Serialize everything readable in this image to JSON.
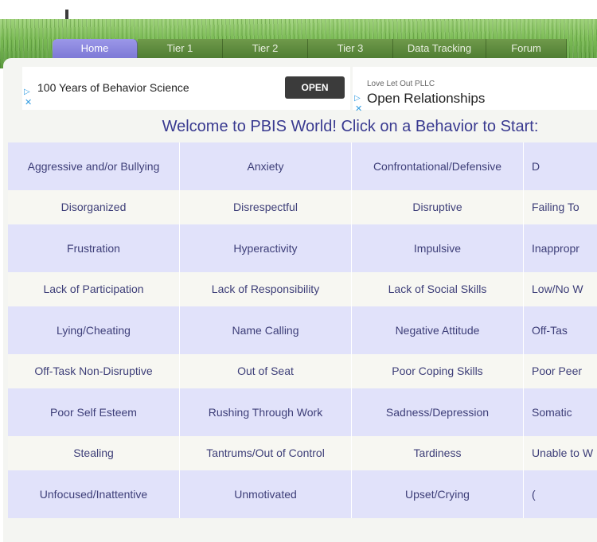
{
  "nav": {
    "items": [
      {
        "label": "Home",
        "active": true
      },
      {
        "label": "Tier 1",
        "active": false
      },
      {
        "label": "Tier 2",
        "active": false
      },
      {
        "label": "Tier 3",
        "active": false
      },
      {
        "label": "Data Tracking",
        "active": false
      },
      {
        "label": "Forum",
        "active": false
      }
    ]
  },
  "ads": {
    "left": {
      "title": "100 Years of Behavior Science",
      "button": "OPEN"
    },
    "right": {
      "sponsor": "Love Let Out PLLC",
      "title": "Open Relationships"
    }
  },
  "welcome": "Welcome to PBIS World! Click on a Behavior to Start:",
  "behaviors": [
    [
      "Aggressive and/or Bullying",
      "Anxiety",
      "Confrontational/Defensive",
      "D"
    ],
    [
      "Disorganized",
      "Disrespectful",
      "Disruptive",
      "Failing To"
    ],
    [
      "Frustration",
      "Hyperactivity",
      "Impulsive",
      "Inappropr"
    ],
    [
      "Lack of Participation",
      "Lack of Responsibility",
      "Lack of Social Skills",
      "Low/No W"
    ],
    [
      "Lying/Cheating",
      "Name Calling",
      "Negative Attitude",
      "Off-Tas"
    ],
    [
      "Off-Task Non-Disruptive",
      "Out of Seat",
      "Poor Coping Skills",
      "Poor Peer"
    ],
    [
      "Poor Self Esteem",
      "Rushing Through Work",
      "Sadness/Depression",
      "Somatic"
    ],
    [
      "Stealing",
      "Tantrums/Out of Control",
      "Tardiness",
      "Unable to W"
    ],
    [
      "Unfocused/Inattentive",
      "Unmotivated",
      "Upset/Crying",
      "("
    ]
  ]
}
